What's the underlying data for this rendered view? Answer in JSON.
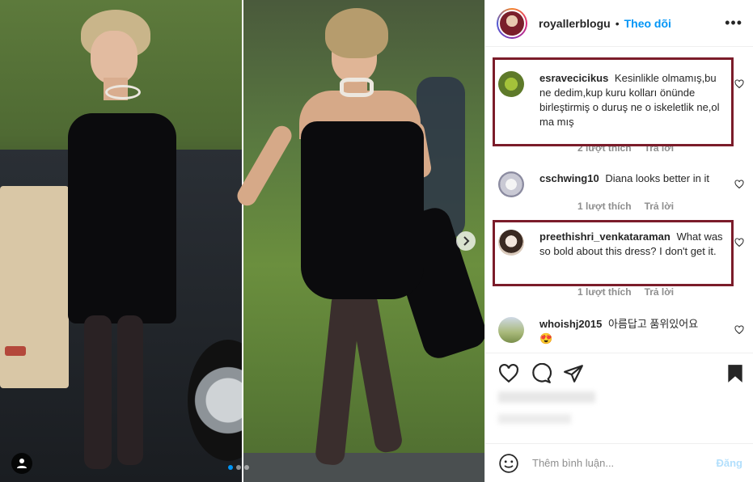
{
  "post": {
    "username": "royallerblogu",
    "separator": "•",
    "follow_label": "Theo dõi",
    "more_label": "•••"
  },
  "comments": [
    {
      "user": "esravecicikus",
      "text": "Kesinlikle olmamış,bu ne dedim,kup kuru kolları önünde birleştirmiş o duruş ne o iskeletlik ne,ol ma mış",
      "likes": "2 lượt thích",
      "reply": "Trả lời",
      "highlighted": true
    },
    {
      "user": "cschwing10",
      "text": "Diana looks better in it",
      "likes": "1 lượt thích",
      "reply": "Trả lời",
      "highlighted": false
    },
    {
      "user": "preethishri_venkataraman",
      "text": "What was so bold about this dress? I don't get it.",
      "likes": "1 lượt thích",
      "reply": "Trả lời",
      "highlighted": true
    },
    {
      "user": "whoishj2015",
      "text": "아름답고 품위있어요",
      "emoji": "😍",
      "highlighted": false
    }
  ],
  "add_comment": {
    "placeholder": "Thêm bình luận...",
    "post_label": "Đăng"
  },
  "carousel": {
    "next_icon": "chevron-right-icon",
    "current_index": 1,
    "total": 3
  },
  "colors": {
    "accent": "#0095f6",
    "highlight_border": "#7b1c2a",
    "post_disabled": "#b2dffc"
  }
}
